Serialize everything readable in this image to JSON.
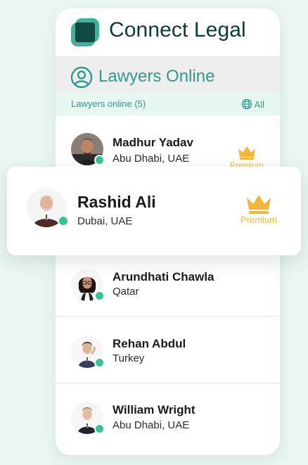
{
  "brand": {
    "name": "Connect Legal",
    "icon": "connect-legal-logo"
  },
  "section": {
    "title": "Lawyers Online",
    "icon": "user-circle-icon"
  },
  "subbar": {
    "online_text": "Lawyers online (5)",
    "filter_label": "All",
    "filter_icon": "globe-icon"
  },
  "colors": {
    "accent": "#2f9c8a",
    "brand_dark": "#0b3b36",
    "premium": "#f4b63a",
    "online": "#36c496",
    "background": "#eaf6f1"
  },
  "lawyers": [
    {
      "name": "Madhur Yadav",
      "location": "Abu Dhabi, UAE",
      "premium": true,
      "badge": "Premium",
      "online": true
    },
    {
      "name": "Rashid Ali",
      "location": "Dubai, UAE",
      "premium": true,
      "badge": "Premium",
      "online": true
    },
    {
      "name": "Arundhati Chawla",
      "location": "Qatar",
      "premium": false,
      "online": true
    },
    {
      "name": "Rehan Abdul",
      "location": "Turkey",
      "premium": false,
      "online": true
    },
    {
      "name": "William Wright",
      "location": "Abu Dhabi, UAE",
      "premium": false,
      "online": true
    }
  ]
}
